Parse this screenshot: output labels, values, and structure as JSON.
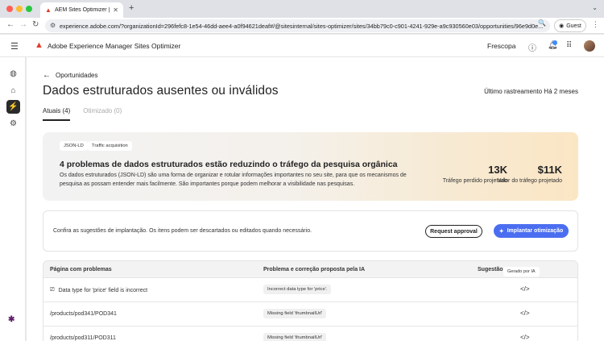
{
  "browser": {
    "tab_title": "AEM Sites Optimizer | Adobe",
    "url": "experience.adobe.com/?organizationId=296fefc8-1e54-46dd-aee4-a0f94621deaf#/@sitesinternal/sites-optimizer/sites/34bb79c0-c901-4241-929e-a9c930560e03/opportunities/96e9d0e...",
    "guest_label": "Guest"
  },
  "header": {
    "app_title": "Adobe Experience Manager Sites Optimizer",
    "org_name": "Frescopa"
  },
  "page": {
    "back_label": "Oportunidades",
    "title": "Dados estruturados ausentes ou inválidos",
    "last_crawl": "Último rastreamento Há 2 meses",
    "tabs": [
      {
        "label": "Atuais (4)",
        "active": true
      },
      {
        "label": "Otimizado (0)",
        "active": false
      }
    ]
  },
  "hero": {
    "chips": [
      "JSON-LD",
      "Traffic acquisition"
    ],
    "heading": "4 problemas de dados estruturados estão reduzindo o tráfego da pesquisa orgânica",
    "description": "Os dados estruturados (JSON-LD) são uma forma de organizar e rotular informações importantes no seu site, para que os mecanismos de pesquisa as possam entender mais facilmente. São importantes porque podem melhorar a visibilidade nas pesquisas.",
    "metrics": [
      {
        "value": "13K",
        "label": "Tráfego perdido projetado"
      },
      {
        "value": "$11K",
        "label": "Valor do tráfego projetado"
      }
    ]
  },
  "confirm": {
    "text": "Confira as sugestões de implantação. Os itens podem ser descartados ou editados quando necessário.",
    "request_approval": "Request approval",
    "deploy": "Implantar otimização"
  },
  "table": {
    "headers": {
      "page": "Página com problemas",
      "issue": "Problema e correção proposta pela IA",
      "suggestion": "Sugestão",
      "ai_badge": "Gerado por IA"
    },
    "rows": [
      {
        "page": "Data type for 'price' field is incorrect",
        "issue": "Incorrect data type for 'price'.",
        "has_icon": true
      },
      {
        "page": "/products/pod341/POD341",
        "issue": "Missing field 'thumbnailUrl'"
      },
      {
        "page": "/products/pod311/POD311",
        "issue": "Missing field 'thumbnailUrl'"
      }
    ]
  },
  "colors": {
    "primary_button": "#4b6ef0",
    "adobe_red": "#e23c2c"
  }
}
